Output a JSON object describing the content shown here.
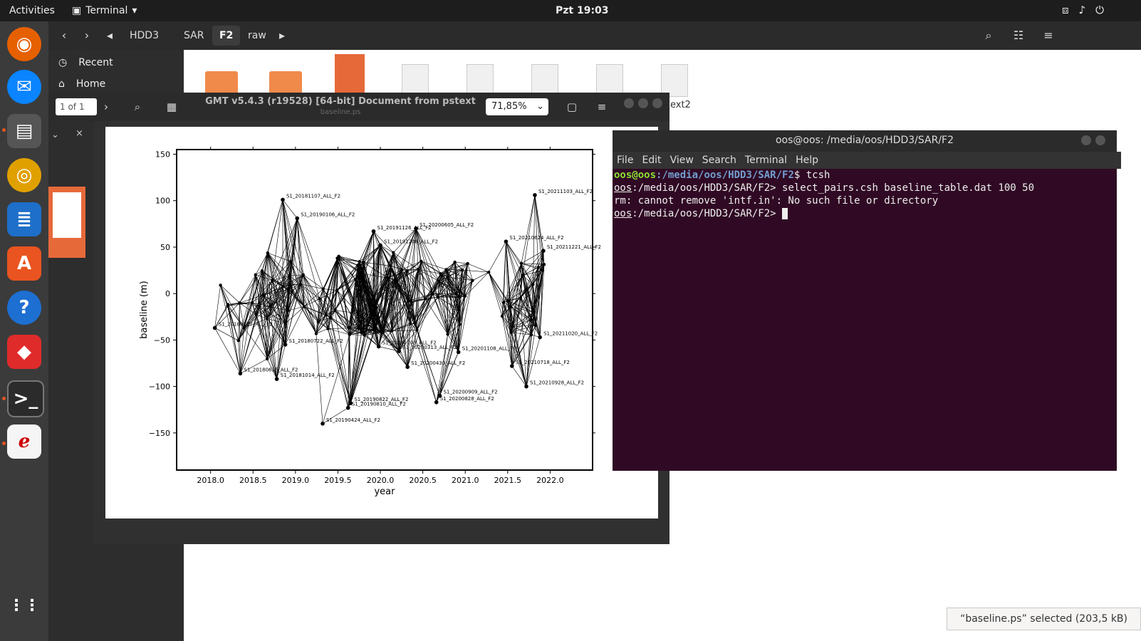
{
  "topbar": {
    "activities": "Activities",
    "app_name": "Terminal",
    "clock": "Pzt 19:03"
  },
  "files": {
    "breadcrumbs": [
      "HDD3",
      "SAR",
      "F2",
      "raw"
    ],
    "sidebar": [
      {
        "label": "Recent"
      },
      {
        "label": "Home"
      }
    ],
    "status": "“baseline.ps” selected (203,5 kB)",
    "partial_label": "ext2"
  },
  "viewer": {
    "title": "GMT v5.4.3 (r19528) [64-bit] Document from pstext",
    "subtitle": "baseline.ps",
    "page_label": "1 of 1",
    "zoom": "71,85%"
  },
  "terminal": {
    "title": "oos@oos: /media/oos/HDD3/SAR/F2",
    "menu": [
      "File",
      "Edit",
      "View",
      "Search",
      "Terminal",
      "Help"
    ],
    "line1_user": "oos@oos",
    "line1_path": ":/media/oos/HDD3/SAR/F2",
    "line1_cmd": "$ tcsh",
    "line2_user": "oos",
    "line2_cmd": ":/media/oos/HDD3/SAR/F2> select_pairs.csh baseline_table.dat 100 50",
    "line3": "rm: cannot remove 'intf.in': No such file or directory",
    "line4_user": "oos",
    "line4_cmd": ":/media/oos/HDD3/SAR/F2> "
  },
  "chart_data": {
    "type": "scatter",
    "xlabel": "year",
    "ylabel": "baseline (m)",
    "xlim": [
      2017.6,
      2022.5
    ],
    "ylim": [
      -190,
      155
    ],
    "xticks": [
      "2018.0",
      "2018.5",
      "2019.0",
      "2019.5",
      "2020.0",
      "2020.5",
      "2021.0",
      "2021.5",
      "2022.0"
    ],
    "yticks": [
      "150",
      "100",
      "50",
      "0",
      "−50",
      "−100",
      "−150"
    ],
    "points": [
      {
        "x": 2018.85,
        "y": 101,
        "label": "S1_20181107_ALL_F2"
      },
      {
        "x": 2019.02,
        "y": 81,
        "label": "S1_20190106_ALL_F2"
      },
      {
        "x": 2019.92,
        "y": 67,
        "label": "S1_20191126_ALL_F2"
      },
      {
        "x": 2020.42,
        "y": 70,
        "label": "S1_20200605_ALL_F2"
      },
      {
        "x": 2021.82,
        "y": 106,
        "label": "S1_20211103_ALL_F2"
      },
      {
        "x": 2021.92,
        "y": 46,
        "label": "S1_20211221_ALL_F2"
      },
      {
        "x": 2020.0,
        "y": 52,
        "label": "S1_20191208_ALL_F2"
      },
      {
        "x": 2021.48,
        "y": 56,
        "label": "S1_20210624_ALL_F2"
      },
      {
        "x": 2018.35,
        "y": -86,
        "label": "S1_20180615_ALL_F2"
      },
      {
        "x": 2018.78,
        "y": -92,
        "label": "S1_20181014_ALL_F2"
      },
      {
        "x": 2018.05,
        "y": -37,
        "label": "S1_20180117_ALL_F2"
      },
      {
        "x": 2019.32,
        "y": -140,
        "label": "S1_20190424_ALL_F2"
      },
      {
        "x": 2019.65,
        "y": -118,
        "label": "S1_20190822_ALL_F2"
      },
      {
        "x": 2019.62,
        "y": -123,
        "label": "S1_20190810_ALL_F2"
      },
      {
        "x": 2020.7,
        "y": -110,
        "label": "S1_20200909_ALL_F2"
      },
      {
        "x": 2020.66,
        "y": -117,
        "label": "S1_20200828_ALL_F2"
      },
      {
        "x": 2021.72,
        "y": -100,
        "label": "S1_20210928_ALL_F2"
      },
      {
        "x": 2021.55,
        "y": -78,
        "label": "S1_20210718_ALL_F2"
      },
      {
        "x": 2020.32,
        "y": -79,
        "label": "S1_20200430_ALL_F2"
      },
      {
        "x": 2020.22,
        "y": -62,
        "label": "S1_20200313_ALL_F2"
      },
      {
        "x": 2020.92,
        "y": -63,
        "label": "S1_20201108_ALL_F2"
      },
      {
        "x": 2019.98,
        "y": -57,
        "label": "S1_20191203_ALL_F2"
      },
      {
        "x": 2021.88,
        "y": -47,
        "label": "S1_20211020_ALL_F2"
      },
      {
        "x": 2018.88,
        "y": -55,
        "label": "S1_20180722_ALL_F2"
      }
    ]
  }
}
